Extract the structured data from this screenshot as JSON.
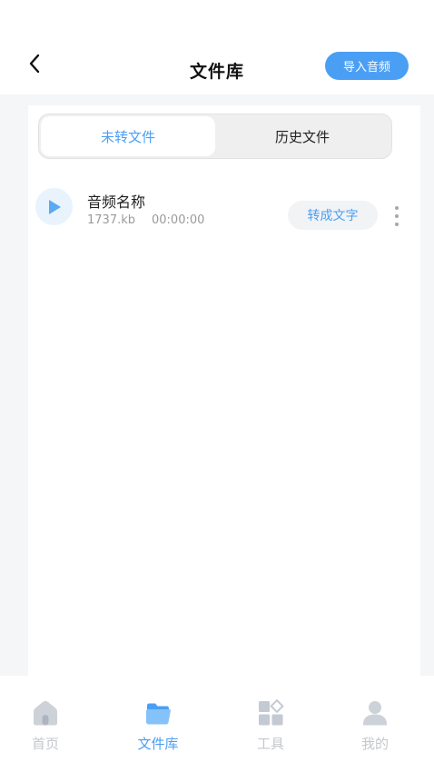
{
  "header": {
    "title": "文件库",
    "import_label": "导入音频"
  },
  "tabs": [
    {
      "label": "未转文件",
      "active": true
    },
    {
      "label": "历史文件",
      "active": false
    }
  ],
  "files": [
    {
      "name": "音频名称",
      "size": "1737.kb",
      "duration": "00:00:00",
      "convert_label": "转成文字"
    }
  ],
  "bottom_nav": [
    {
      "label": "首页",
      "icon": "home-icon",
      "active": false
    },
    {
      "label": "文件库",
      "icon": "folder-icon",
      "active": true
    },
    {
      "label": "工具",
      "icon": "tools-icon",
      "active": false
    },
    {
      "label": "我的",
      "icon": "user-icon",
      "active": false
    }
  ],
  "colors": {
    "accent": "#4a9ff5",
    "inactive_nav": "#c4c7cc",
    "background": "#f5f6f8"
  }
}
